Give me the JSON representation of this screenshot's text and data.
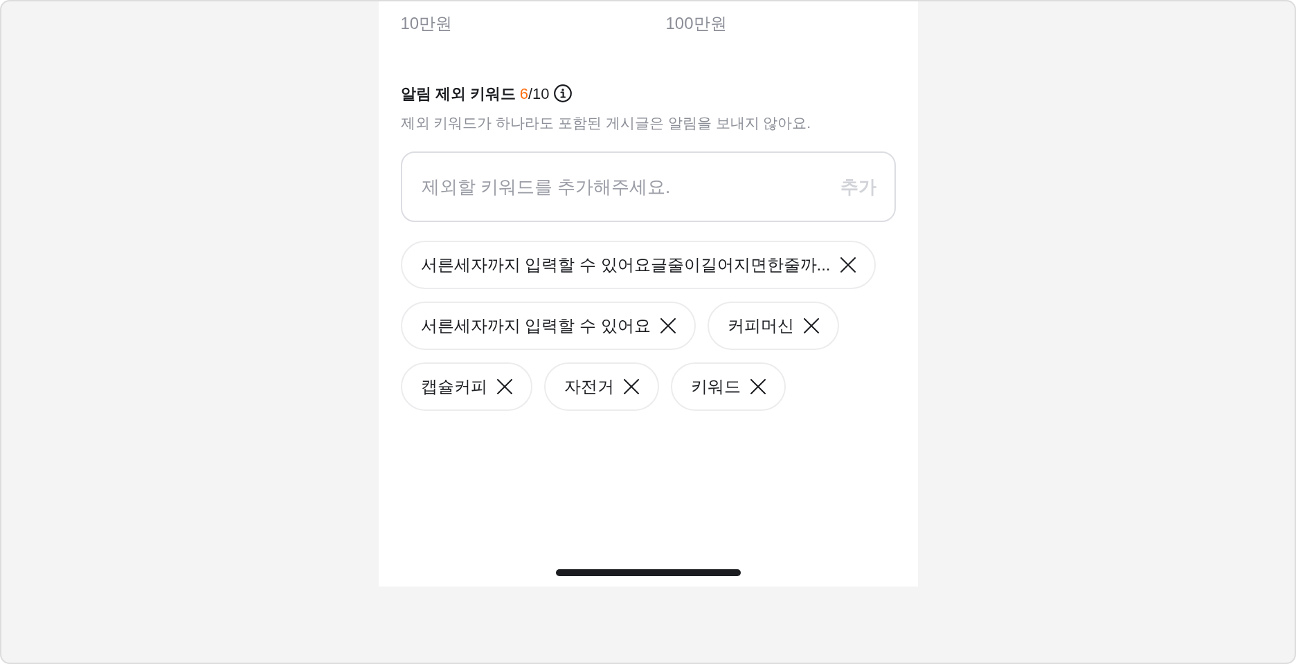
{
  "price_range": {
    "min_label": "10만원",
    "max_label": "100만원"
  },
  "exclude_keywords": {
    "title": "알림 제외 키워드",
    "count": "6",
    "limit": "/10",
    "description": "제외 키워드가 하나라도 포함된 게시글은 알림을 보내지 않아요.",
    "input": {
      "placeholder": "제외할 키워드를 추가해주세요.",
      "add_button": {
        "label": "추가",
        "disabled": true
      }
    },
    "keywords": [
      {
        "label": "서른세자까지 입력할 수 있어요글줄이길어지면한줄까..."
      },
      {
        "label": "서른세자까지 입력할 수 있어요"
      },
      {
        "label": "커피머신"
      },
      {
        "label": "캡슐커피"
      },
      {
        "label": "자전거"
      },
      {
        "label": "키워드"
      }
    ]
  }
}
